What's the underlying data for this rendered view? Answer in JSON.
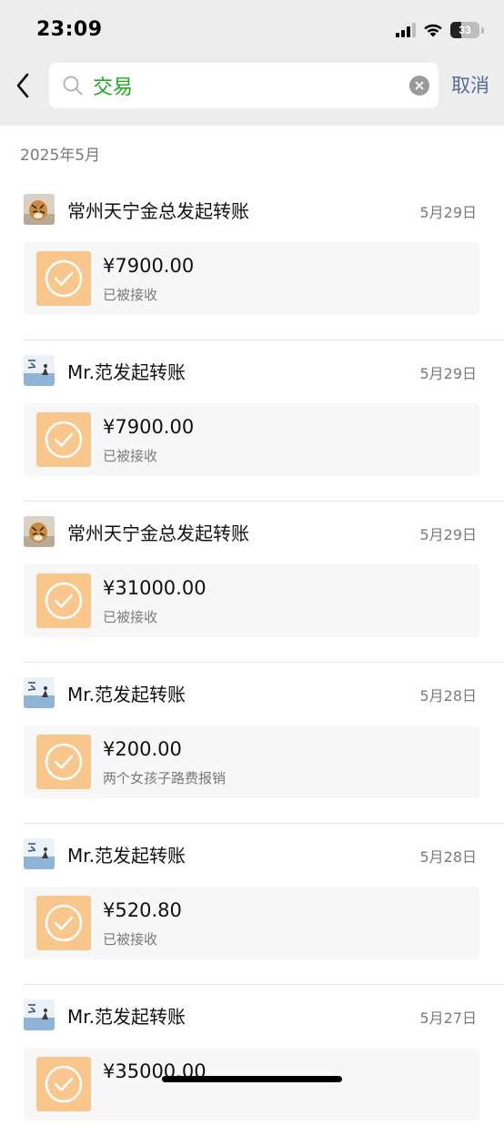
{
  "status_bar": {
    "time": "23:09",
    "battery": "33"
  },
  "search": {
    "query": "交易",
    "cancel_label": "取消"
  },
  "section": {
    "header": "2025年5月"
  },
  "entries": [
    {
      "sender": "常州天宁金总发起转账",
      "date": "5月29日",
      "amount": "¥7900.00",
      "status": "已被接收",
      "avatar": "tiger"
    },
    {
      "sender": "Mr.范发起转账",
      "date": "5月29日",
      "amount": "¥7900.00",
      "status": "已被接收",
      "avatar": "landscape"
    },
    {
      "sender": "常州天宁金总发起转账",
      "date": "5月29日",
      "amount": "¥31000.00",
      "status": "已被接收",
      "avatar": "tiger"
    },
    {
      "sender": "Mr.范发起转账",
      "date": "5月28日",
      "amount": "¥200.00",
      "status": "两个女孩子路费报销",
      "avatar": "landscape"
    },
    {
      "sender": "Mr.范发起转账",
      "date": "5月28日",
      "amount": "¥520.80",
      "status": "已被接收",
      "avatar": "landscape"
    },
    {
      "sender": "Mr.范发起转账",
      "date": "5月27日",
      "amount": "¥35000.00",
      "status": "",
      "avatar": "landscape"
    }
  ],
  "icons": {
    "back": "chevron-left-icon",
    "search": "search-icon",
    "clear": "clear-icon",
    "transfer_received": "check-circle-icon"
  },
  "colors": {
    "accent_link": "#576b95",
    "search_text": "#1aad19",
    "transfer_card_icon": "#f9c68b"
  }
}
